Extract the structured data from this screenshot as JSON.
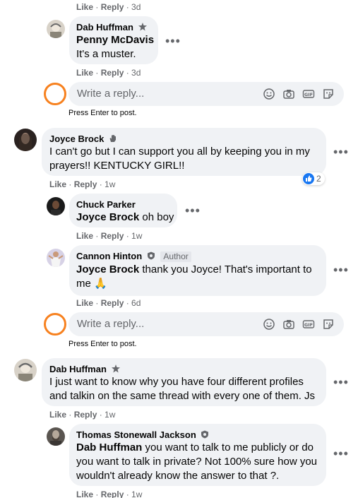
{
  "colors": {
    "bubble": "#f0f2f5",
    "muted": "#65676b",
    "ring": "#f7811f",
    "like_blue": "#1877f2"
  },
  "action_labels": {
    "like": "Like",
    "reply": "Reply"
  },
  "reply_box": {
    "placeholder": "Write a reply...",
    "hint": "Press Enter to post."
  },
  "comments": [
    {
      "actions_time": "3d"
    },
    {
      "author": "Dab Huffman",
      "tag": "Penny McDavis",
      "text": "It's a muster.",
      "time": "3d",
      "icon": "star-badge-icon"
    },
    {
      "author": "Joyce Brock",
      "text_line1": "I can't go but I can support you all by keeping you in my",
      "text_line2": "prayers!! KENTUCKY GIRL!!",
      "time": "1w",
      "reaction_count": "2",
      "icon": "wave-icon"
    },
    {
      "author": "Chuck Parker",
      "tag": "Joyce Brock",
      "text": "oh boy",
      "time": "1w"
    },
    {
      "author": "Cannon Hinton",
      "author_badge": "Author",
      "tag": "Joyce Brock",
      "text_line1": "thank you Joyce! That's important to",
      "text_line2": "me 🙏",
      "time": "6d",
      "icon": "shield-badge-icon"
    },
    {
      "author": "Dab Huffman",
      "text_line1": "I just want to know why you have four different profiles",
      "text_line2": "and talkin on the same thread with every one of them. Js",
      "time": "1w",
      "icon": "star-badge-icon"
    },
    {
      "author": "Thomas Stonewall Jackson",
      "tag": "Dab Huffman",
      "text_line1": "you want to talk to me publicly or do",
      "text_line2": "you want to talk in private? Not 100% sure how you",
      "text_line3": "wouldn't already know the answer to that ?.",
      "time": "1w",
      "icon": "shield-badge-icon"
    }
  ]
}
